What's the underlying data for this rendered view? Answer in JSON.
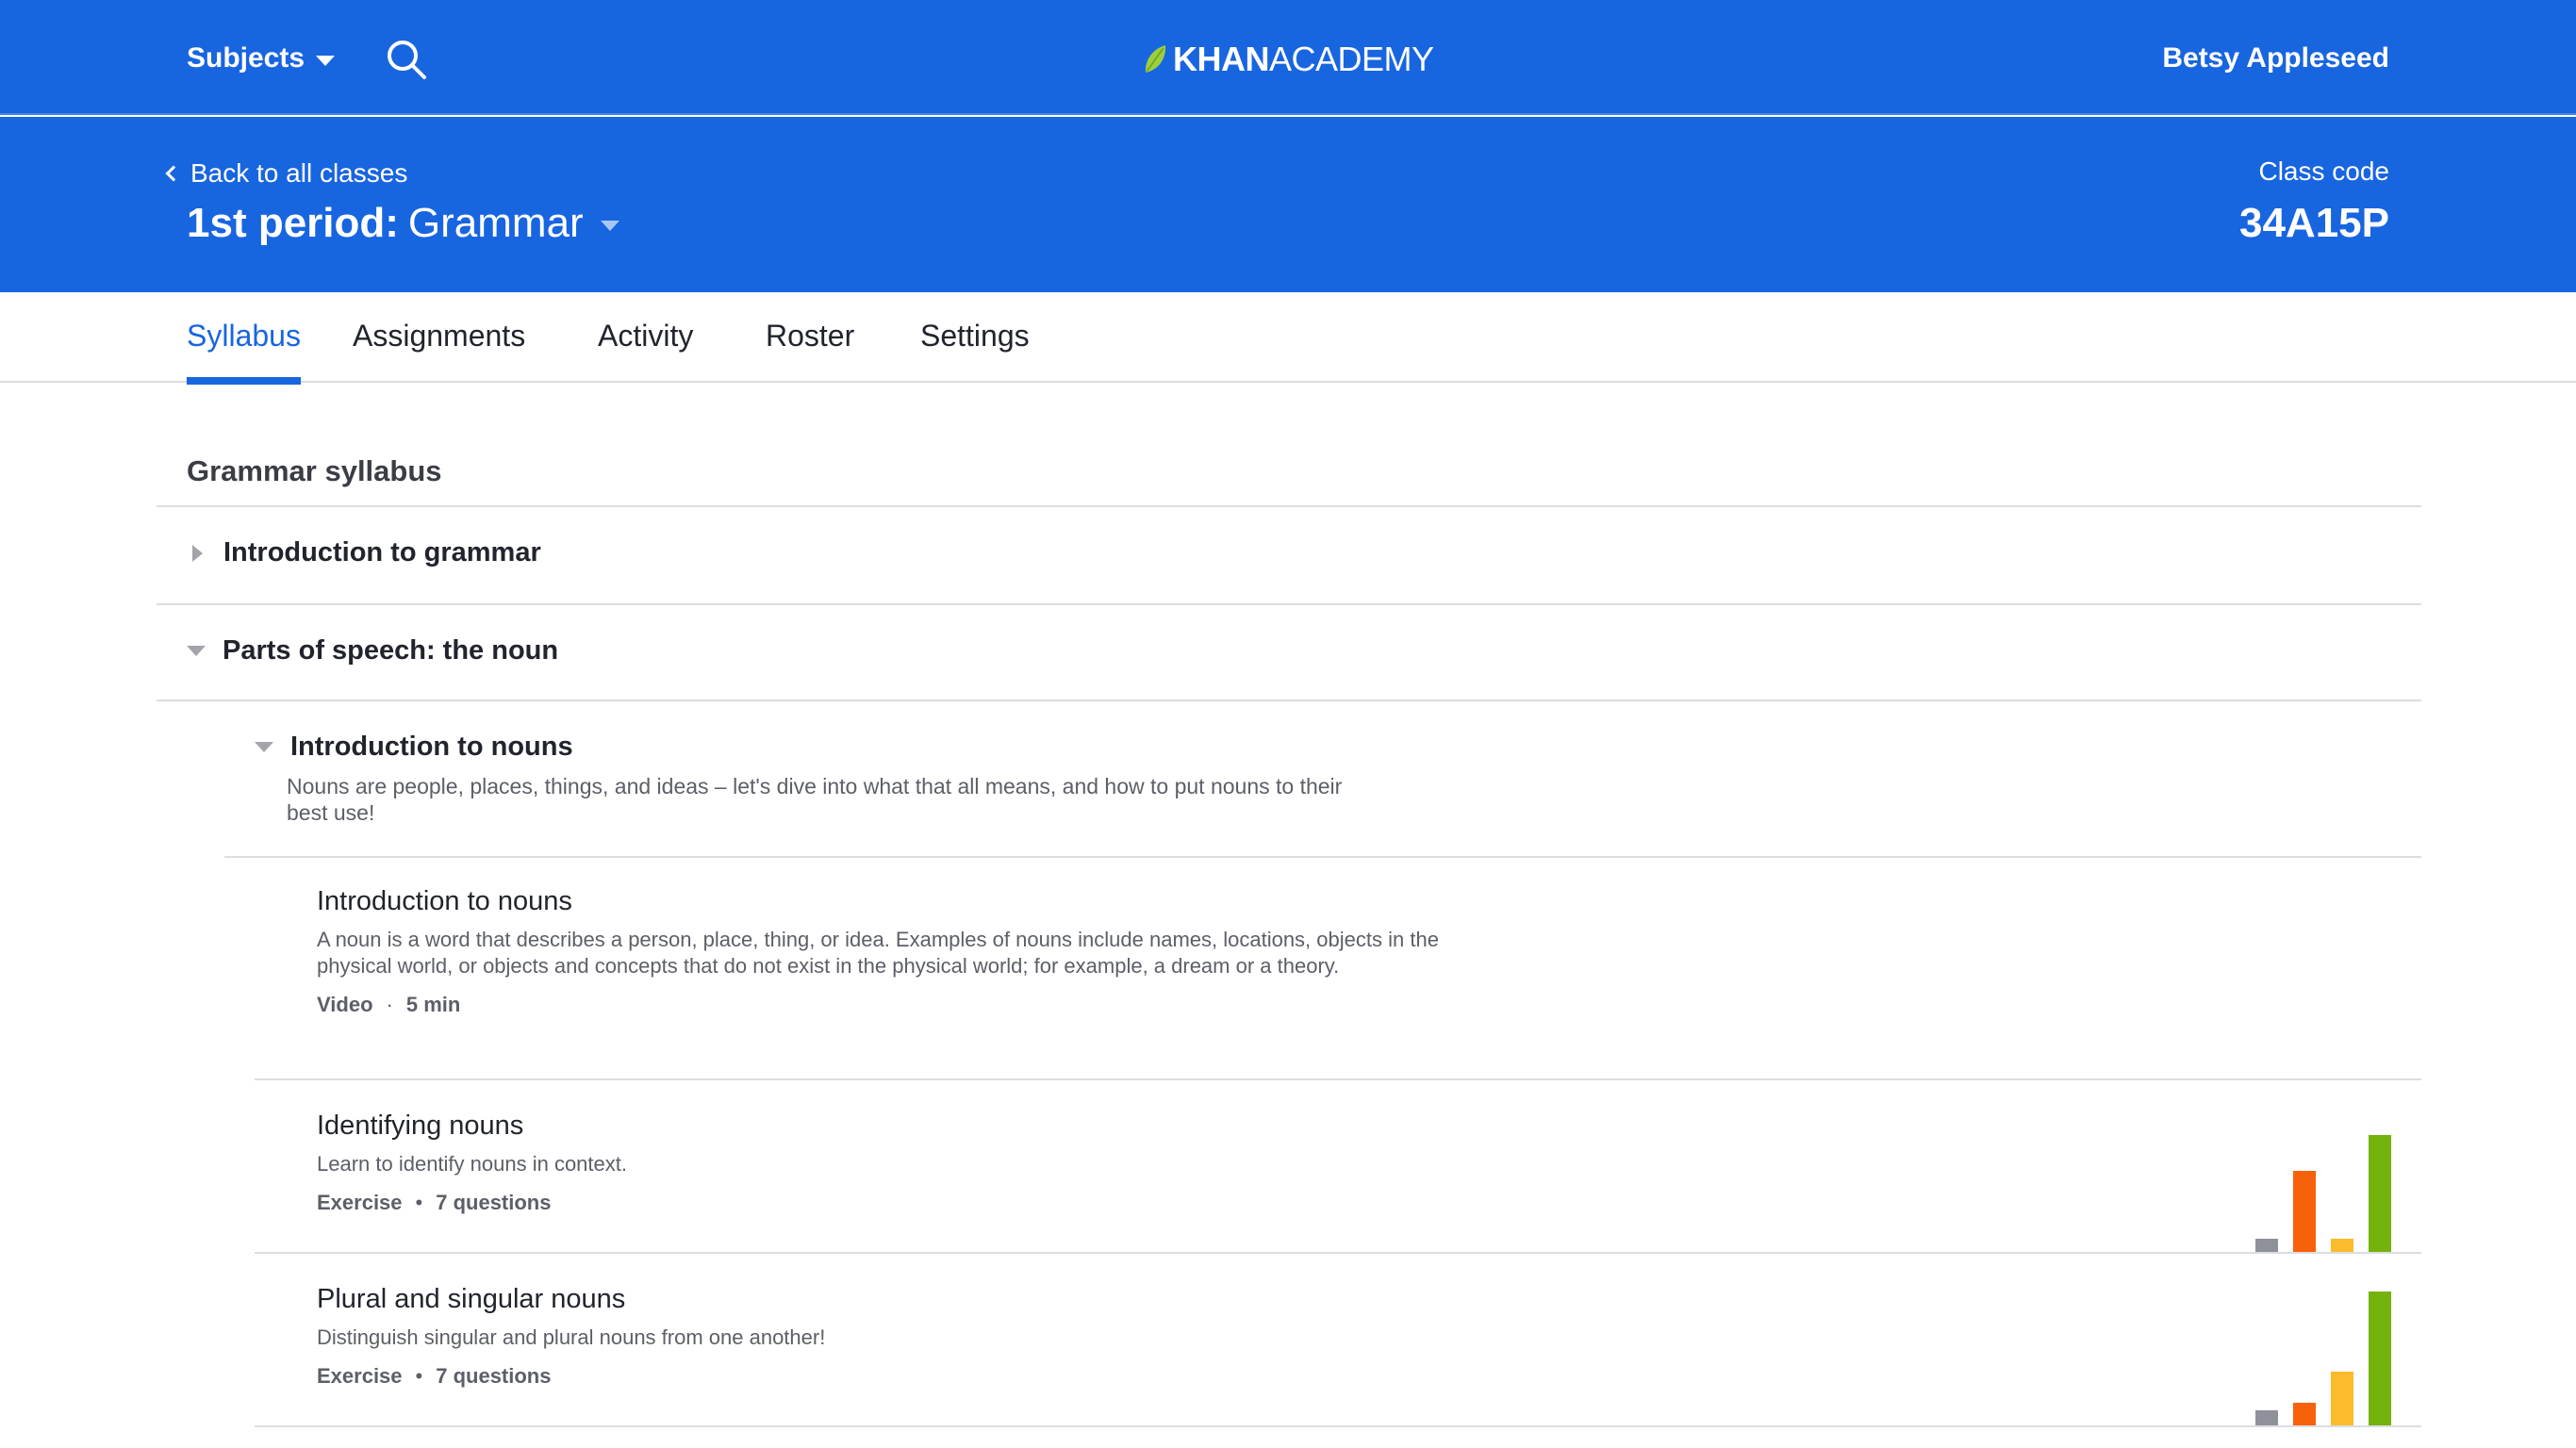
{
  "topnav": {
    "subjects_label": "Subjects",
    "logo_khan": "KHAN",
    "logo_academy": "ACADEMY",
    "user_name": "Betsy Appleseed",
    "colors": {
      "background": "#1865e0",
      "leaf": "#9bcf3e"
    }
  },
  "class_header": {
    "back_label": "Back to all classes",
    "period": "1st period:",
    "class_name": "Grammar",
    "code_label": "Class code",
    "code": "34A15P"
  },
  "tabs": [
    {
      "label": "Syllabus",
      "active": true
    },
    {
      "label": "Assignments",
      "active": false
    },
    {
      "label": "Activity",
      "active": false
    },
    {
      "label": "Roster",
      "active": false
    },
    {
      "label": "Settings",
      "active": false
    }
  ],
  "syllabus": {
    "title": "Grammar syllabus",
    "units": [
      {
        "title": "Introduction to grammar",
        "expanded": false
      },
      {
        "title": "Parts of speech: the noun",
        "expanded": true
      }
    ],
    "lesson": {
      "title": "Introduction to nouns",
      "description": "Nouns are people, places, things, and ideas – let's dive into what that all means, and how to put nouns to their best use!"
    },
    "items": [
      {
        "title": "Introduction to nouns",
        "description": "A noun is a word that describes a person, place, thing, or idea. Examples of nouns include names, locations, objects in the physical world, or objects and concepts that do not exist in the physical world; for example, a dream or a theory.",
        "type": "Video",
        "separator": "·",
        "detail": "5 min"
      },
      {
        "title": "Identifying nouns",
        "description": "Learn to identify nouns in context.",
        "type": "Exercise",
        "separator": "•",
        "detail": "7 questions",
        "mastery_levels": [
          0.11,
          0.69,
          0.11,
          1.0
        ]
      },
      {
        "title": "Plural and singular nouns",
        "description": "Distinguish singular and plural nouns from one another!",
        "type": "Exercise",
        "separator": "•",
        "detail": "7 questions",
        "mastery_levels": [
          0.11,
          0.17,
          0.4,
          1.0
        ]
      }
    ],
    "bar_colors": [
      "#8e9199",
      "#f7610b",
      "#fbbb2a",
      "#74b20c"
    ]
  }
}
